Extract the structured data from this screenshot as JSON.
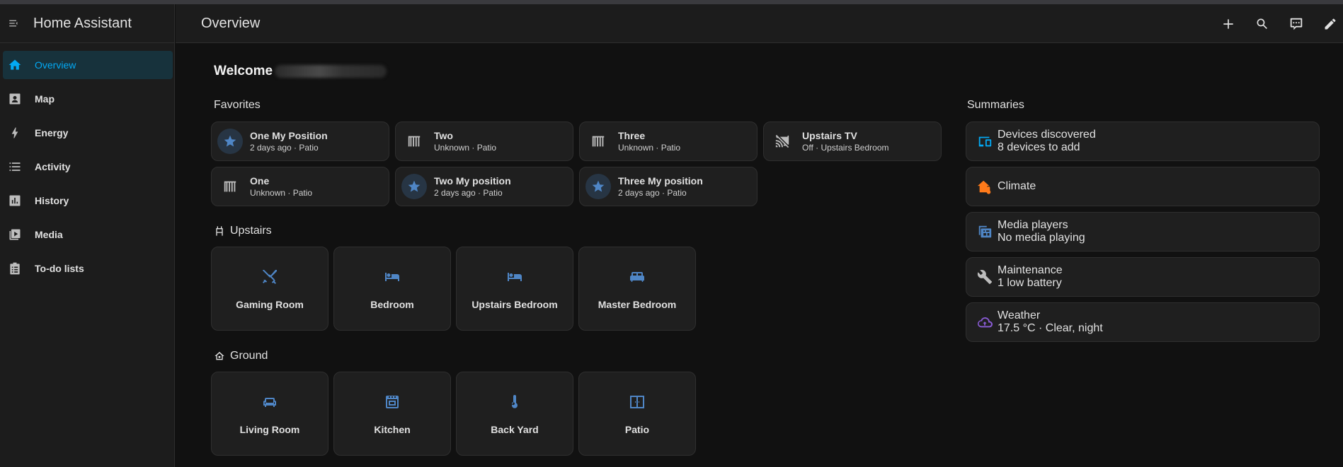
{
  "app": {
    "title": "Home Assistant"
  },
  "sidebar": {
    "items": [
      {
        "label": "Overview",
        "icon": "home-icon"
      },
      {
        "label": "Map",
        "icon": "map-person-icon"
      },
      {
        "label": "Energy",
        "icon": "lightning-icon"
      },
      {
        "label": "Activity",
        "icon": "list-icon"
      },
      {
        "label": "History",
        "icon": "chart-box-icon"
      },
      {
        "label": "Media",
        "icon": "play-box-icon"
      },
      {
        "label": "To-do lists",
        "icon": "clipboard-list-icon"
      }
    ]
  },
  "header": {
    "title": "Overview"
  },
  "welcome": {
    "text": "Welcome"
  },
  "favorites": {
    "title": "Favorites",
    "tiles": [
      {
        "name": "One My Position",
        "state": "2 days ago · Patio"
      },
      {
        "name": "Two",
        "state": "Unknown · Patio"
      },
      {
        "name": "Three",
        "state": "Unknown · Patio"
      },
      {
        "name": "Upstairs TV",
        "state": "Off · Upstairs Bedroom"
      },
      {
        "name": "One",
        "state": "Unknown · Patio"
      },
      {
        "name": "Two My position",
        "state": "2 days ago · Patio"
      },
      {
        "name": "Three My position",
        "state": "2 days ago · Patio"
      }
    ]
  },
  "upstairs": {
    "title": "Upstairs",
    "areas": [
      "Gaming Room",
      "Bedroom",
      "Upstairs Bedroom",
      "Master Bedroom"
    ]
  },
  "ground": {
    "title": "Ground",
    "areas": [
      "Living Room",
      "Kitchen",
      "Back Yard",
      "Patio"
    ]
  },
  "summaries": {
    "title": "Summaries",
    "items": [
      {
        "name": "Devices discovered",
        "state": "8 devices to add"
      },
      {
        "name": "Climate",
        "state": ""
      },
      {
        "name": "Media players",
        "state": "No media playing"
      },
      {
        "name": "Maintenance",
        "state": "1 low battery"
      },
      {
        "name": "Weather",
        "state": "17.5 °C · Clear, night"
      }
    ]
  },
  "colors": {
    "accent": "#03a9f4",
    "area_icon": "#4f86c6",
    "climate": "#ff7a1a",
    "weather": "#8a5cd6"
  }
}
